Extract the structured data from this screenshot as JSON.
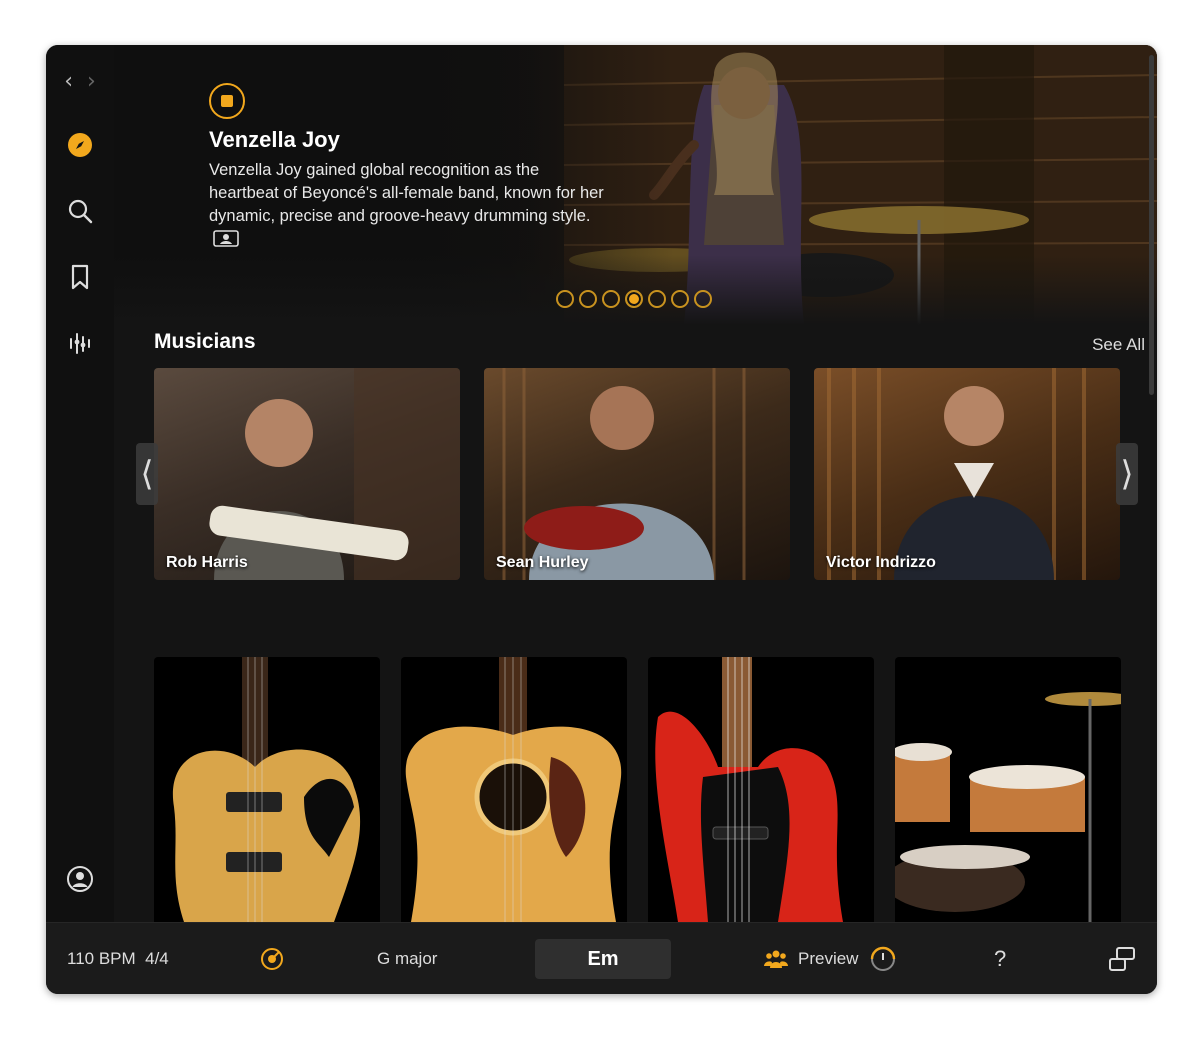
{
  "nav": {
    "back": "‹",
    "forward": "›"
  },
  "sidebar": {
    "items": [
      {
        "icon": "compass-icon",
        "active": true
      },
      {
        "icon": "search-icon"
      },
      {
        "icon": "bookmark-icon"
      },
      {
        "icon": "mixer-icon"
      },
      {
        "icon": "account-icon"
      }
    ]
  },
  "hero": {
    "title": "Venzella Joy",
    "description": "Venzella Joy gained global recognition as the heartbeat of Beyoncé's all-female band, known for her dynamic, precise and groove-heavy drumming style.",
    "video_icon": "video-icon",
    "pager_count": 7,
    "pager_active": 4
  },
  "musicians": {
    "title": "Musicians",
    "see_all": "See All",
    "cards": [
      {
        "name": "Rob Harris"
      },
      {
        "name": "Sean Hurley"
      },
      {
        "name": "Victor Indrizzo"
      }
    ]
  },
  "instruments": [
    {
      "icon": "electric-jazz-guitar"
    },
    {
      "icon": "acoustic-guitar"
    },
    {
      "icon": "bass-guitar"
    },
    {
      "icon": "drum-kit"
    }
  ],
  "bottombar": {
    "tempo": "110 BPM",
    "signature": "4/4",
    "key": "G major",
    "chord": "Em",
    "preview": "Preview",
    "help": "?"
  },
  "colors": {
    "accent": "#f2a81d",
    "background": "#141414",
    "bar": "#1b1b1b"
  }
}
